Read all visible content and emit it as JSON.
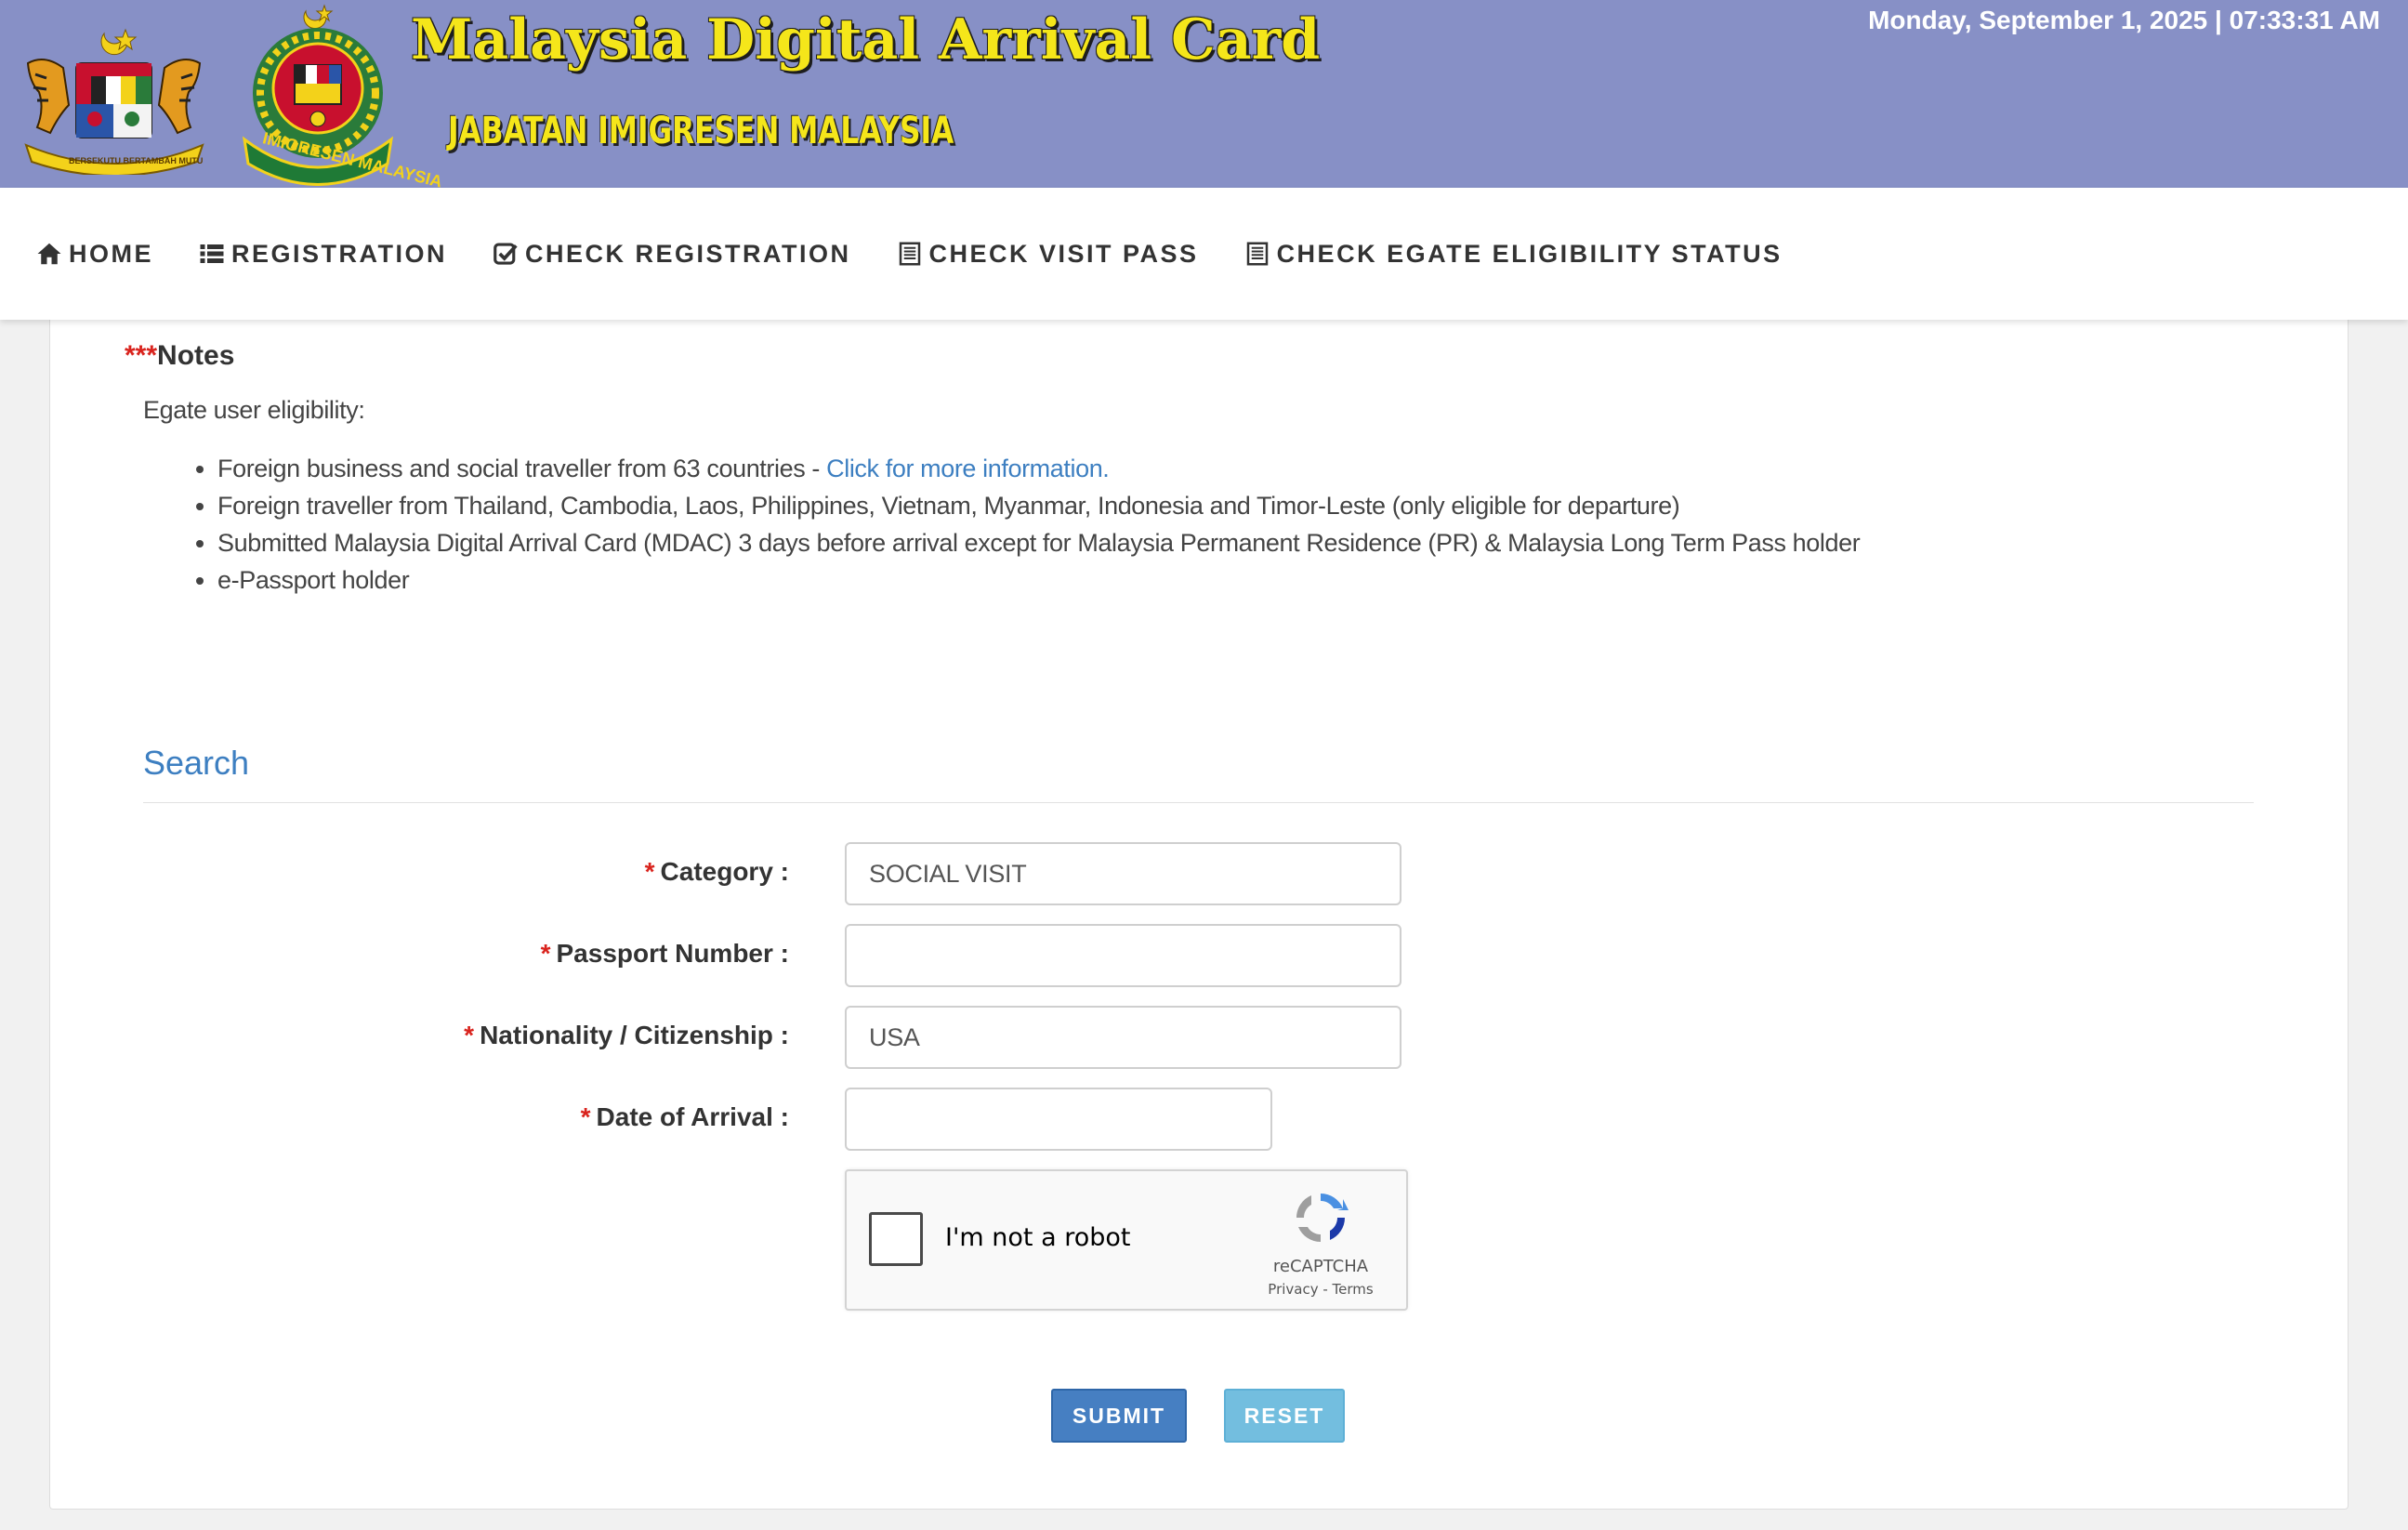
{
  "header": {
    "title": "Malaysia Digital Arrival Card",
    "subtitle": "JABATAN IMIGRESEN MALAYSIA",
    "datetime": "Monday, September 1, 2025 | 07:33:31 AM",
    "emblem_ribbon": "BERSEKUTU BERTAMBAH MUTU",
    "logo_ribbon": "IMIGRESEN MALAYSIA"
  },
  "nav": {
    "items": [
      {
        "label": "HOME",
        "icon": "home-icon"
      },
      {
        "label": "REGISTRATION",
        "icon": "list-icon"
      },
      {
        "label": "CHECK REGISTRATION",
        "icon": "check-square-icon"
      },
      {
        "label": "CHECK VISIT PASS",
        "icon": "document-icon"
      },
      {
        "label": "CHECK EGATE ELIGIBILITY STATUS",
        "icon": "document-icon"
      }
    ]
  },
  "notes": {
    "stars": "***",
    "title": "Notes",
    "intro": "Egate user eligibility:",
    "items": [
      "Foreign business and social traveller from 63 countries - ",
      "Foreign traveller from Thailand, Cambodia, Laos, Philippines, Vietnam, Myanmar, Indonesia and Timor-Leste (only eligible for departure)",
      "Submitted Malaysia Digital Arrival Card (MDAC) 3 days before arrival except for Malaysia Permanent Residence (PR) & Malaysia Long Term Pass holder",
      "e-Passport holder"
    ],
    "more_info_link": "Click for more information."
  },
  "search": {
    "title": "Search",
    "required_mark": "*",
    "fields": {
      "category": {
        "label": "Category :",
        "value": "SOCIAL VISIT"
      },
      "passport": {
        "label": "Passport Number :",
        "value": ""
      },
      "nationality": {
        "label": "Nationality / Citizenship :",
        "value": "USA"
      },
      "arrival": {
        "label": "Date of Arrival :",
        "value": ""
      }
    }
  },
  "recaptcha": {
    "label": "I'm not a robot",
    "brand": "reCAPTCHA",
    "links": "Privacy - Terms"
  },
  "buttons": {
    "submit": "SUBMIT",
    "reset": "RESET"
  },
  "colors": {
    "header_bg": "#8790c6",
    "title_yellow": "#f5e61a",
    "link_blue": "#3d7fc1",
    "required_red": "#d9231d",
    "submit_blue": "#467fc2",
    "reset_blue": "#73bedf"
  }
}
